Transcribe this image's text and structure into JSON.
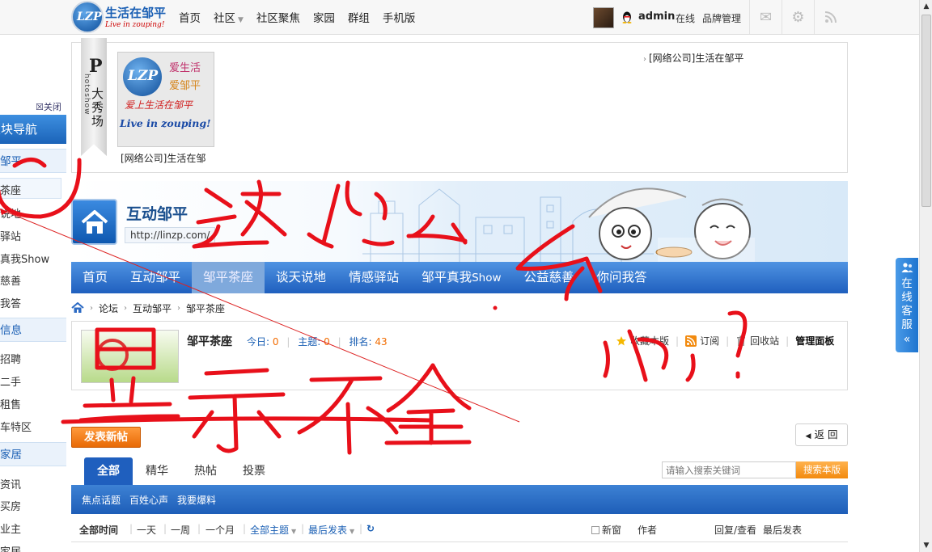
{
  "topbar": {
    "logo_title": "生活在邹平",
    "logo_sub": "Live in zouping!",
    "logo_mark": "LZP",
    "nav": [
      {
        "label": "首页",
        "has_caret": false
      },
      {
        "label": "社区",
        "has_caret": true
      },
      {
        "label": "社区聚焦",
        "has_caret": false
      },
      {
        "label": "家园",
        "has_caret": false
      },
      {
        "label": "群组",
        "has_caret": false
      },
      {
        "label": "手机版",
        "has_caret": false
      }
    ],
    "user_name": "admin",
    "user_status": "在线",
    "brand_mgmt": "品牌管理",
    "icons": [
      "mail-icon",
      "gear-icon",
      "rss-icon"
    ]
  },
  "sidebar": {
    "close_label": "☒关闭",
    "head_label": "版块导航",
    "groups": [
      {
        "label": "邹平",
        "items": [
          "茶座",
          "说地",
          "驿站",
          "真我Show",
          "慈善",
          "我答"
        ]
      },
      {
        "label": "信息",
        "items": [
          "招聘",
          "二手",
          "租售",
          "车特区"
        ]
      },
      {
        "label": "家居",
        "items": [
          "资讯",
          "买房",
          "业主",
          "家居"
        ]
      }
    ],
    "active_item": "茶座"
  },
  "photoshow": {
    "ribbon_letter": "P",
    "ribbon_sub": "hotoshow",
    "ribbon_title": "大秀场",
    "thumb_lines": [
      "爱生活",
      "爱邹平",
      "爱上生活在邹平",
      "Live in zouping!"
    ],
    "caption": "[网络公司]生活在邹",
    "side_link": "[网络公司]生活在邹平"
  },
  "banner": {
    "title": "互动邹平",
    "url": "http://linzp.com/"
  },
  "mainnav": {
    "items": [
      {
        "label": "首页",
        "active": false
      },
      {
        "label": "互动邹平",
        "active": false
      },
      {
        "label": "邹平茶座",
        "active": true
      },
      {
        "label": "谈天说地",
        "active": false
      },
      {
        "label": "情感驿站",
        "active": false
      },
      {
        "label": "邹平真我",
        "suffix": "Show",
        "active": false
      },
      {
        "label": "公益慈善",
        "active": false
      },
      {
        "label": "你问我答",
        "active": false
      }
    ]
  },
  "breadcrumb": [
    "论坛",
    "互动邹平",
    "邹平茶座"
  ],
  "forum": {
    "name": "邹平茶座",
    "today_label": "今日:",
    "today_value": "0",
    "topics_label": "主题:",
    "topics_value": "0",
    "rank_label": "排名:",
    "rank_value": "43",
    "actions": [
      "收藏本版",
      "订阅",
      "回收站"
    ],
    "admin_panel": "管理面板"
  },
  "buttons": {
    "new_post": "发表新帖",
    "back": "返 回"
  },
  "tabs": [
    {
      "label": "全部",
      "active": true
    },
    {
      "label": "精华",
      "active": false
    },
    {
      "label": "热帖",
      "active": false
    },
    {
      "label": "投票",
      "active": false
    }
  ],
  "search": {
    "placeholder": "请输入搜索关键词",
    "button": "搜索本版"
  },
  "subbar": [
    "焦点话题",
    "百姓心声",
    "我要爆料"
  ],
  "filters": {
    "all_time": "全部时间",
    "ranges": [
      "一天",
      "一周",
      "一个月"
    ],
    "all_topics": "全部主题",
    "last_post_sort": "最后发表",
    "new_window": "新窗",
    "author": "作者",
    "reply_view": "回复/查看",
    "last_post": "最后发表"
  },
  "service": {
    "label": "在线客服",
    "collapse": "«"
  },
  "annotation": {
    "color": "#e8101a",
    "text_top": "这怎么办?",
    "text_bottom": "显示不全"
  },
  "colors": {
    "nav_blue": "#1f5fbe",
    "accent_orange": "#f26c00"
  }
}
